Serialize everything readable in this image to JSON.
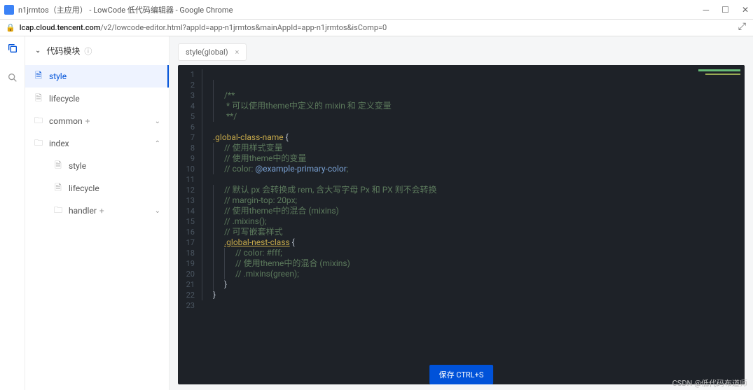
{
  "browser": {
    "title": "n1jrmtos（主应用） - LowCode 低代码编辑器 - Google Chrome",
    "url_host": "lcap.cloud.tencent.com",
    "url_path": "/v2/lowcode-editor.html?appId=app-n1jrmtos&mainAppId=app-n1jrmtos&isComp=0"
  },
  "sidebar": {
    "header": "代码模块",
    "items": [
      {
        "label": "style"
      },
      {
        "label": "lifecycle"
      },
      {
        "label": "common"
      },
      {
        "label": "index"
      },
      {
        "label": "style"
      },
      {
        "label": "lifecycle"
      },
      {
        "label": "handler"
      }
    ]
  },
  "tab": {
    "label": "style(global)"
  },
  "code": {
    "l1": "",
    "l2": "",
    "l3": "/**",
    "l4": " * 可以使用theme中定义的 mixin 和 定义变量",
    "l5": " **/",
    "l6": "",
    "l7_a": ".global-class-name",
    "l7_b": " {",
    "l8": "// 使用样式变量",
    "l9": "// 使用theme中的变量",
    "l10_a": "// color: ",
    "l10_b": "@example-primary-color",
    "l10_c": ";",
    "l11": "",
    "l12": "// 默认 px 会转换成 rem, 含大写字母 Px 和 PX 则不会转换",
    "l13": "// margin-top: 20px;",
    "l14": "// 使用theme中的混合 (mixins)",
    "l15": "// .mixins();",
    "l16": "// 可写嵌套样式",
    "l17_a": ".global-nest-class",
    "l17_b": " {",
    "l18": "// color: #fff;",
    "l19": "// 使用theme中的混合 (mixins)",
    "l20": "// .mixins(green);",
    "l21": "}",
    "l22": "}",
    "l23": ""
  },
  "save_btn": "保存 CTRL+S",
  "watermark": "CSDN @低代码布道师"
}
